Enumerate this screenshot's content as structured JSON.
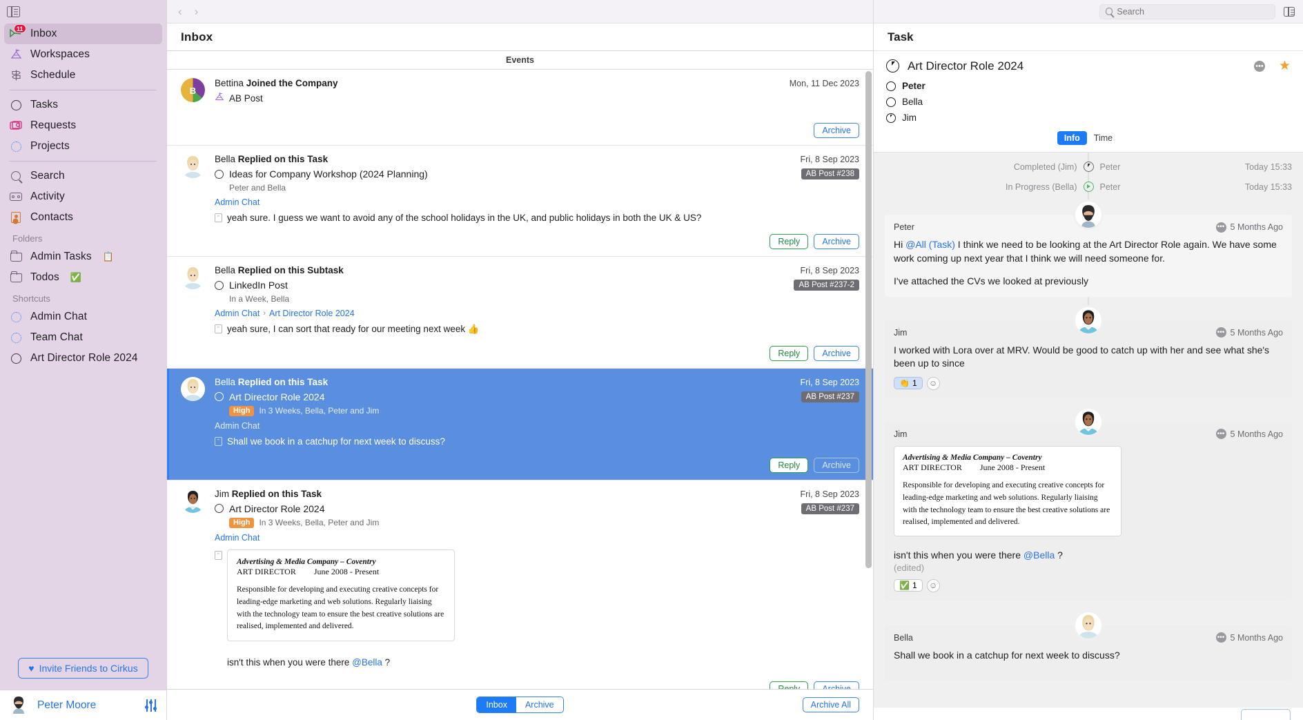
{
  "sidebar": {
    "panel_toggle_icon": "panel-toggle-icon",
    "items": [
      {
        "label": "Inbox",
        "icon": "inbox-icon",
        "badge": "11",
        "active": true
      },
      {
        "label": "Workspaces",
        "icon": "workspaces-icon"
      },
      {
        "label": "Schedule",
        "icon": "schedule-icon"
      },
      {
        "label": "Tasks",
        "icon": "circle-icon"
      },
      {
        "label": "Requests",
        "icon": "requests-icon"
      },
      {
        "label": "Projects",
        "icon": "dotted-circle-icon"
      },
      {
        "label": "Search",
        "icon": "search-icon"
      },
      {
        "label": "Activity",
        "icon": "activity-icon"
      },
      {
        "label": "Contacts",
        "icon": "contacts-icon"
      }
    ],
    "folders_header": "Folders",
    "folders": [
      {
        "label": "Admin Tasks",
        "emoji": "📋"
      },
      {
        "label": "Todos",
        "emoji": "✅"
      }
    ],
    "shortcuts_header": "Shortcuts",
    "shortcuts": [
      {
        "label": "Admin Chat",
        "icon": "dotted-circle-icon"
      },
      {
        "label": "Team Chat",
        "icon": "dotted-circle-icon"
      },
      {
        "label": "Art Director Role 2024",
        "icon": "circle-icon"
      }
    ],
    "invite_label": "Invite Friends to Cirkus",
    "invite_heart": "♥",
    "user_name": "Peter Moore"
  },
  "center": {
    "nav_back": "‹",
    "nav_forward": "›",
    "title": "Inbox",
    "events_label": "Events",
    "events": [
      {
        "author": "Bettina",
        "action": "Joined the Company",
        "date": "Mon, 11 Dec 2023",
        "workspace": "AB Post",
        "workspace_icon": "workspaces-icon",
        "buttons": [
          "Archive"
        ],
        "selected": false
      },
      {
        "author": "Bella",
        "action": "Replied on this Task",
        "date": "Fri, 8 Sep 2023",
        "task_title": "Ideas for Company Workshop (2024 Planning)",
        "tag": "AB Post #238",
        "meta": "Peter and Bella",
        "breadcrumb": [
          "Admin Chat"
        ],
        "message": "yeah sure.  I guess we want to avoid any of the school holidays in the UK, and public holidays in both the UK & US?",
        "buttons": [
          "Reply",
          "Archive"
        ],
        "selected": false
      },
      {
        "author": "Bella",
        "action": "Replied on this Subtask",
        "date": "Fri, 8 Sep 2023",
        "task_title": "LinkedIn Post",
        "tag": "AB Post #237-2",
        "meta": "In a Week, Bella",
        "breadcrumb": [
          "Admin Chat",
          "Art Director Role 2024"
        ],
        "message": "yeah sure, I can sort that ready for our meeting next week 👍",
        "buttons": [
          "Reply",
          "Archive"
        ],
        "selected": false
      },
      {
        "author": "Bella",
        "action": "Replied on this Task",
        "date": "Fri, 8 Sep 2023",
        "task_title": "Art Director Role 2024",
        "tag": "AB Post #237",
        "priority": "High",
        "meta": "In 3 Weeks, Bella, Peter and Jim",
        "breadcrumb": [
          "Admin Chat"
        ],
        "message": "Shall we book in a catchup for next week to discuss?",
        "buttons": [
          "Reply",
          "Archive"
        ],
        "selected": true
      },
      {
        "author": "Jim",
        "action": "Replied on this Task",
        "date": "Fri, 8 Sep 2023",
        "task_title": "Art Director Role 2024",
        "tag": "AB Post #237",
        "priority": "High",
        "meta": "In 3 Weeks, Bella, Peter and Jim",
        "breadcrumb": [
          "Admin Chat"
        ],
        "cv": {
          "company": "Advertising & Media Company – Coventry",
          "role": "ART DIRECTOR",
          "dates": "June 2008 - Present",
          "body": "Responsible for developing and executing creative concepts for leading-edge marketing and web solutions. Regularly liaising with the technology team to ensure the best creative solutions are realised, implemented and delivered."
        },
        "message_prefix": "isn't this when you were there ",
        "mention": "@Bella",
        "message_suffix": " ?",
        "buttons": [
          "Reply",
          "Archive"
        ],
        "selected": false
      }
    ],
    "footer": {
      "segment": [
        "Inbox",
        "Archive"
      ],
      "segment_active": "Inbox",
      "archive_all": "Archive All"
    }
  },
  "right": {
    "search_placeholder": "Search",
    "search_value": "",
    "panel_toggle_icon": "panel-toggle-icon",
    "title": "Task",
    "task_name": "Art Director Role 2024",
    "task_status_icon": "partial-clock-icon",
    "more_icon": "more-dots-icon",
    "star_icon": "star-icon",
    "star_glyph": "★",
    "people": [
      {
        "name": "Peter",
        "bold": true,
        "state": "open"
      },
      {
        "name": "Bella",
        "bold": false,
        "state": "open"
      },
      {
        "name": "Jim",
        "bold": false,
        "state": "partial"
      }
    ],
    "tabs": [
      {
        "label": "Info",
        "active": true
      },
      {
        "label": "Time",
        "active": false
      }
    ],
    "timeline": [
      {
        "left": "Completed (Jim)",
        "icon": "completed-icon",
        "right": "Peter",
        "time": "Today 15:33"
      },
      {
        "left": "In Progress (Bella)",
        "icon": "in-progress-icon",
        "right": "Peter",
        "time": "Today 15:33"
      }
    ],
    "messages": [
      {
        "author": "Peter",
        "avatar": "peter-avatar",
        "ago": "5 Months Ago",
        "mention": "@All (Task)",
        "text_before": "Hi ",
        "text_after": " I think we need to be looking at the Art Director Role again.  We have some work coming up next year that I think we will need someone for.",
        "paragraph2": "I've attached the CVs we looked at previously"
      },
      {
        "author": "Jim",
        "avatar": "jim-avatar",
        "ago": "5 Months Ago",
        "text": "I worked with Lora over at MRV.  Would be good to catch up with her and see what she's been up to since",
        "reactions": [
          {
            "emoji": "👏",
            "count": "1",
            "selected": true
          }
        ]
      },
      {
        "author": "Jim",
        "avatar": "jim-avatar",
        "ago": "5 Months Ago",
        "cv": {
          "company": "Advertising & Media Company – Coventry",
          "role": "ART DIRECTOR",
          "dates": "June 2008 - Present",
          "body": "Responsible for developing and executing creative concepts for leading-edge marketing and web solutions. Regularly liaising with the technology team to ensure the best creative solutions are realised, implemented and delivered."
        },
        "text_before": "isn't this when you were there ",
        "mention": "@Bella",
        "text_after": " ?",
        "edited": "(edited)",
        "reactions": [
          {
            "emoji": "✅",
            "count": "1",
            "selected": false
          }
        ]
      },
      {
        "author": "Bella",
        "avatar": "bella-avatar",
        "ago": "5 Months Ago",
        "text": "Shall we book in a catchup for next week to discuss?"
      }
    ]
  },
  "colors": {
    "sidebar_bg": "#e4d5e6",
    "accent_blue": "#2574e8",
    "selected_row": "#5a8fe0",
    "priority_high": "#f0933f",
    "tag_grey": "#6f6d73",
    "badge_red": "#e8113c",
    "star_orange": "#f2a02e",
    "green": "#1f8a40"
  }
}
